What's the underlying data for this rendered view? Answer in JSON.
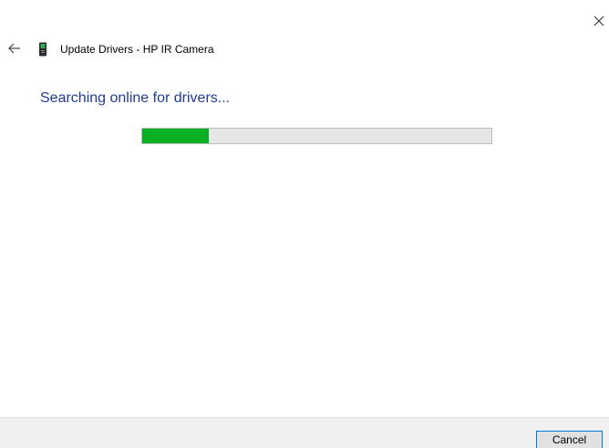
{
  "window": {
    "title": "Update Drivers - HP IR Camera",
    "icons": {
      "close": "close-icon",
      "back": "back-arrow-icon",
      "device": "camera-device-icon"
    }
  },
  "main": {
    "heading": "Searching online for drivers...",
    "progress": {
      "fraction": 0.19,
      "fill_color": "#06b025",
      "track_color": "#e6e6e6"
    },
    "heading_color": "#1f3c99"
  },
  "footer": {
    "cancel_label": "Cancel",
    "button_border_color": "#0078d7"
  }
}
